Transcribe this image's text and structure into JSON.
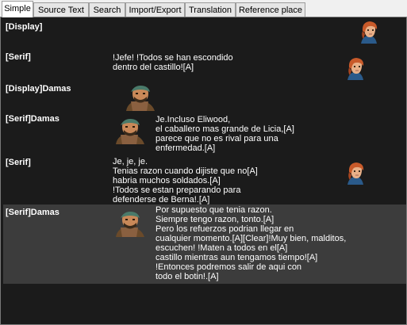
{
  "tabs": [
    {
      "label": "Simple"
    },
    {
      "label": "Source Text"
    },
    {
      "label": "Search"
    },
    {
      "label": "Import/Export"
    },
    {
      "label": "Translation"
    },
    {
      "label": "Reference place"
    }
  ],
  "rows": [
    {
      "label": "[Display]",
      "text": "",
      "portrait": "right",
      "character": "red-haired-lord"
    },
    {
      "label": "[Serif]",
      "text": "!Jefe! !Todos se han escondido\ndentro del castillo![A]",
      "portrait": "right",
      "character": "red-haired-lord"
    },
    {
      "label": "[Display]Damas",
      "text": "",
      "portrait": "left",
      "character": "bandit-damas"
    },
    {
      "label": "[Serif]Damas",
      "text": "Je.Incluso Eliwood,\nel caballero mas grande de Licia,[A]\nparece que no es rival para una\nenfermedad.[A]",
      "portrait": "left",
      "character": "bandit-damas"
    },
    {
      "label": "[Serif]",
      "text": "Je, je, je.\nTenias razon cuando dijiste que no[A]\nhabria muchos soldados.[A]\n!Todos se estan preparando para\ndefenderse de Berna!.[A]",
      "portrait": "right",
      "character": "red-haired-lord"
    },
    {
      "label": "[Serif]Damas",
      "text": "Por supuesto que tenia razon.\nSiempre tengo razon, tonto.[A]\nPero los refuerzos podrian llegar en\ncualquier momento.[A][Clear]!Muy bien, malditos,\nescuchen! !Maten a todos en el[A]\ncastillo mientras aun tengamos tiempo![A]\n!Entonces podremos salir de aqui con\ntodo el botin!.[A]",
      "portrait": "left",
      "character": "bandit-damas",
      "selected": true
    }
  ],
  "colors": {
    "panel_bg": "#1b1b1b",
    "selected_row_bg": "#3c3c3c",
    "text": "#ffffff"
  }
}
